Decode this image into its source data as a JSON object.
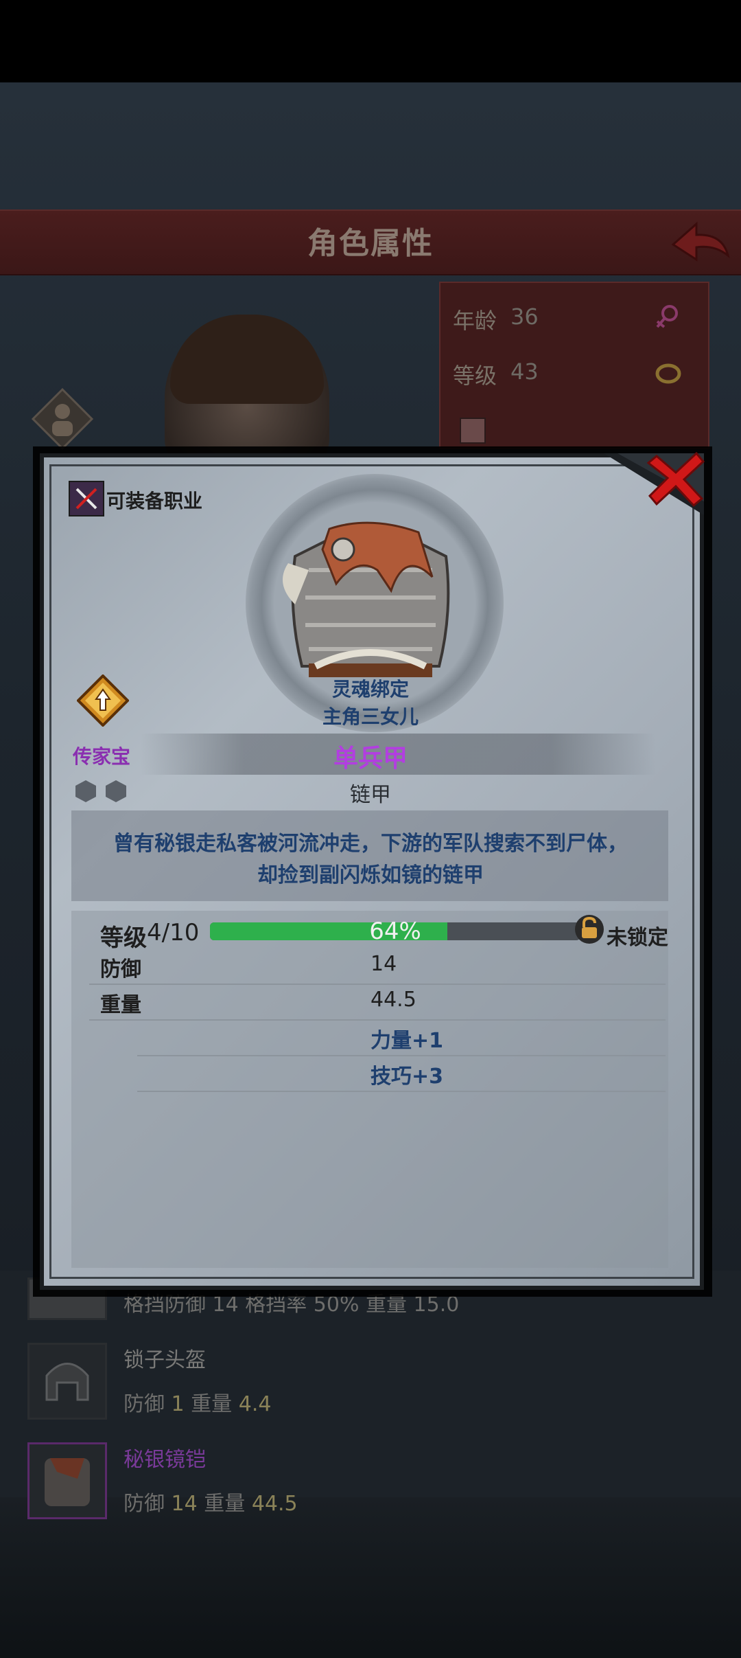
{
  "header": {
    "title": "角色属性"
  },
  "character": {
    "age_label": "年龄",
    "age": "36",
    "level_label": "等级",
    "level": "43"
  },
  "list": [
    {
      "name": "",
      "stats_text": "格挡防御 14 格挡率 50% 重量 15.0"
    },
    {
      "name": "锁子头盔",
      "defense_label": "防御",
      "defense": "1",
      "weight_label": "重量",
      "weight": "4.4"
    },
    {
      "name": "秘银镜铠",
      "defense_label": "防御",
      "defense": "14",
      "weight_label": "重量",
      "weight": "44.5"
    }
  ],
  "modal": {
    "job_label": "可装备职业",
    "soul_bound": "灵魂绑定",
    "owner": "主角三女儿",
    "rarity": "传家宝",
    "item_name": "单兵甲",
    "item_type": "链甲",
    "description_line1": "曾有秘银走私客被河流冲走，下游的军队搜索不到尸体，",
    "description_line2": "却捡到副闪烁如镜的链甲",
    "level_label": "等级",
    "level_value": "4/10",
    "xp_percent_text": "64%",
    "xp_fraction": 0.64,
    "lock_label": "未锁定",
    "stats": [
      {
        "label": "防御",
        "value": "14"
      },
      {
        "label": "重量",
        "value": "44.5"
      }
    ],
    "bonuses": [
      "力量+1",
      "技巧+3"
    ]
  },
  "colors": {
    "header_red": "#4a1d1d",
    "legendary_purple": "#b23ee0",
    "xp_green": "#2eb04c",
    "desc_blue": "#1e3f6e",
    "close_red": "#d01818"
  },
  "icons": {
    "back": "back-arrow-icon",
    "close": "close-icon",
    "job": "crossed-tools-icon",
    "heirloom": "heirloom-upgrade-icon",
    "lock": "padlock-icon",
    "gender": "female-icon",
    "ring": "ring-icon"
  }
}
